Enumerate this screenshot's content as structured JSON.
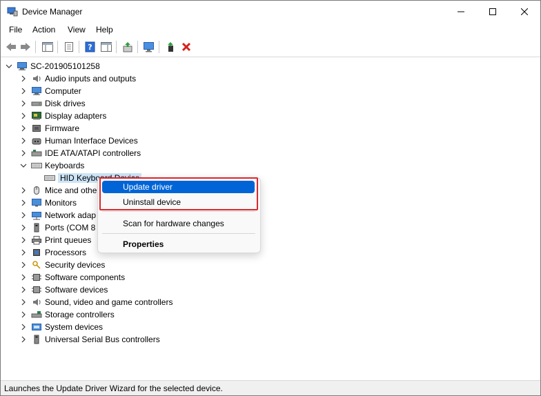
{
  "window": {
    "title": "Device Manager"
  },
  "menu": [
    "File",
    "Action",
    "View",
    "Help"
  ],
  "tree": {
    "root": "SC-201905101258",
    "categories": [
      "Audio inputs and outputs",
      "Computer",
      "Disk drives",
      "Display adapters",
      "Firmware",
      "Human Interface Devices",
      "IDE ATA/ATAPI controllers",
      "Keyboards",
      "Mice and othe",
      "Monitors",
      "Network adap",
      "Ports (COM 8",
      "Print queues",
      "Processors",
      "Security devices",
      "Software components",
      "Software devices",
      "Sound, video and game controllers",
      "Storage controllers",
      "System devices",
      "Universal Serial Bus controllers"
    ],
    "selected_child": "HID Keyboard Device"
  },
  "context_menu": {
    "items": [
      "Update driver",
      "Uninstall device",
      "Scan for hardware changes",
      "Properties"
    ]
  },
  "status": {
    "text": "Launches the Update Driver Wizard for the selected device."
  },
  "colors": {
    "accent": "#0064d6",
    "highlight_box": "#e0252a",
    "selection": "#cce4f7"
  }
}
